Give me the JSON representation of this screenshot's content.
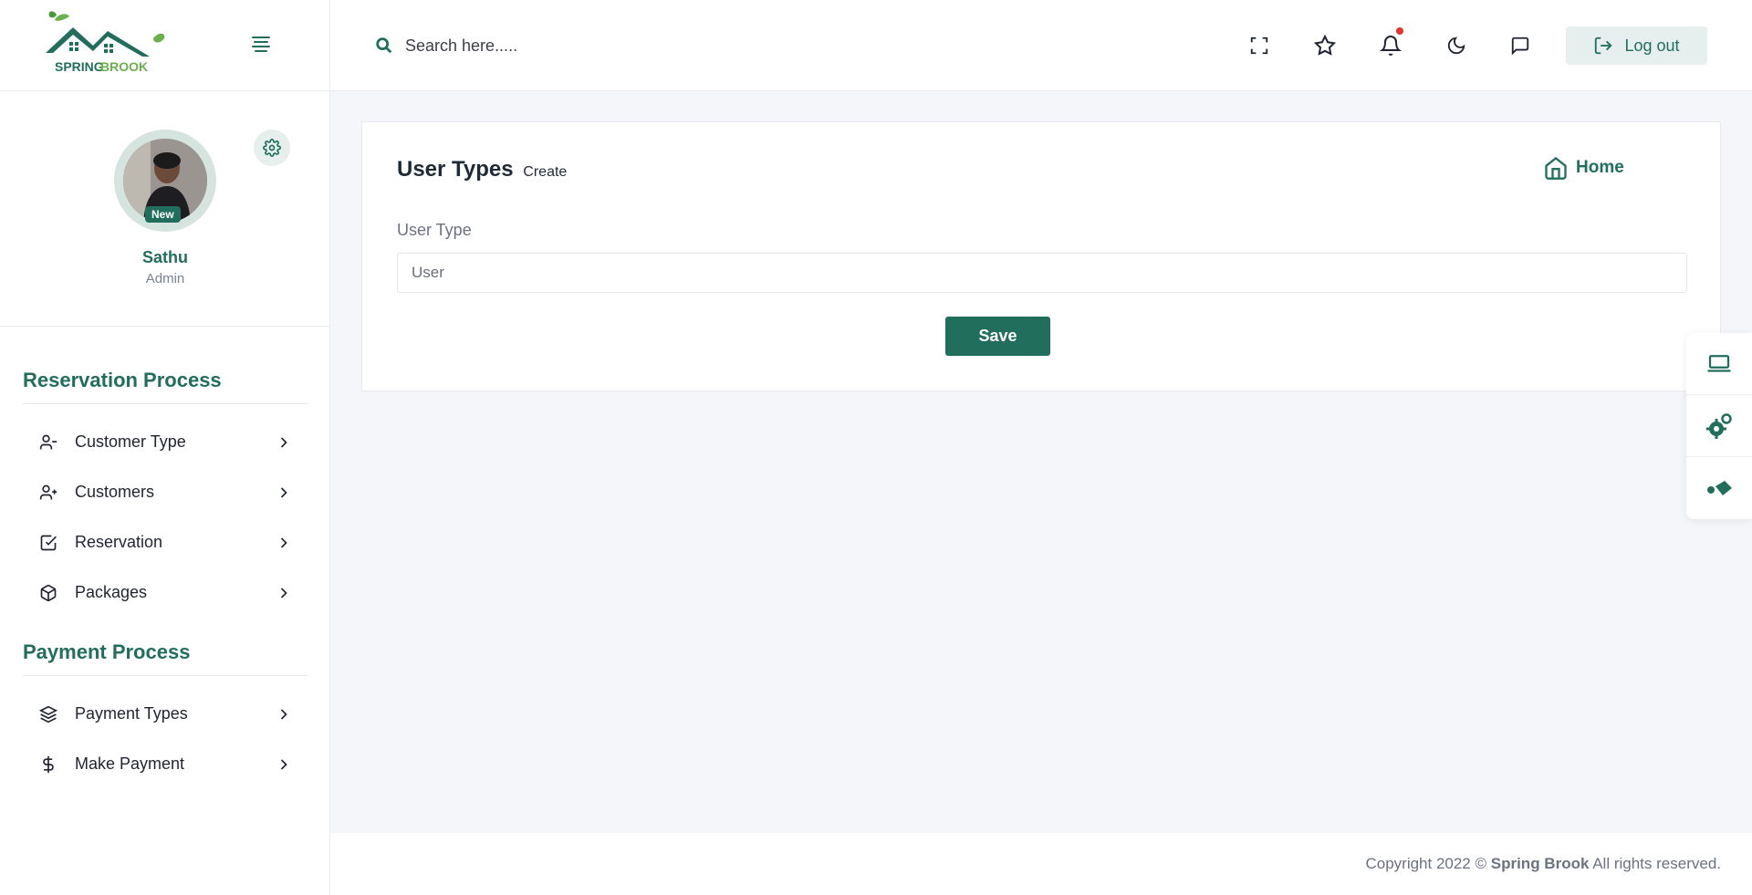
{
  "brand": {
    "name_part1": "SPRING",
    "name_part2": "BROOK",
    "accent": "#216e5d",
    "leaf": "#6ab04c"
  },
  "profile": {
    "badge": "New",
    "name": "Sathu",
    "role": "Admin"
  },
  "topbar": {
    "search_placeholder": "Search here.....",
    "logout_label": "Log out"
  },
  "sidebar": {
    "sections": [
      {
        "title": "Reservation Process",
        "items": [
          {
            "label": "Customer Type",
            "icon": "user-minus-icon"
          },
          {
            "label": "Customers",
            "icon": "user-plus-icon"
          },
          {
            "label": "Reservation",
            "icon": "check-square-icon"
          },
          {
            "label": "Packages",
            "icon": "box-icon"
          }
        ]
      },
      {
        "title": "Payment Process",
        "items": [
          {
            "label": "Payment Types",
            "icon": "layers-icon"
          },
          {
            "label": "Make Payment",
            "icon": "dollar-icon"
          }
        ]
      }
    ]
  },
  "page": {
    "title": "User Types",
    "subtitle": "Create",
    "home_label": "Home",
    "field_label": "User Type",
    "field_placeholder": "User",
    "save_label": "Save"
  },
  "footer": {
    "prefix": "Copyright 2022 ©",
    "brand": "Spring Brook",
    "suffix": "All rights reserved."
  }
}
